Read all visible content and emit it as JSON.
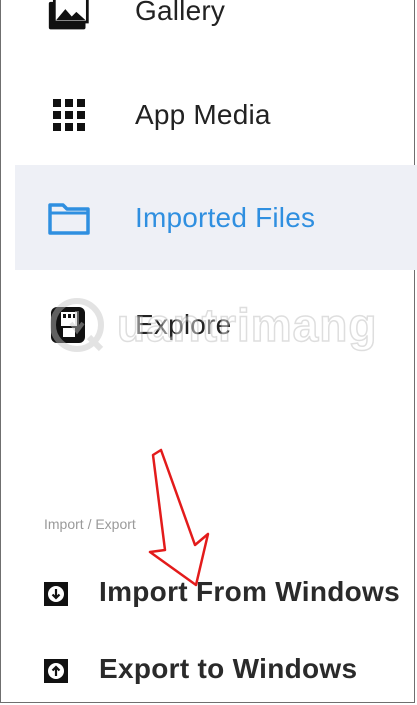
{
  "menu": {
    "items": [
      {
        "label": "Gallery",
        "icon": "gallery-icon"
      },
      {
        "label": "App Media",
        "icon": "grid-icon"
      },
      {
        "label": "Imported Files",
        "icon": "folder-icon",
        "active": true
      },
      {
        "label": "Explore",
        "icon": "explore-icon"
      }
    ]
  },
  "section": {
    "import_export_label": "Import / Export"
  },
  "actions": {
    "import_label": "Import From Windows",
    "export_label": "Export to Windows"
  },
  "watermark": {
    "text": "uantrimang"
  },
  "colors": {
    "accent": "#2f8fe0",
    "active_bg": "#eef0f6",
    "arrow": "#e31b1b"
  }
}
